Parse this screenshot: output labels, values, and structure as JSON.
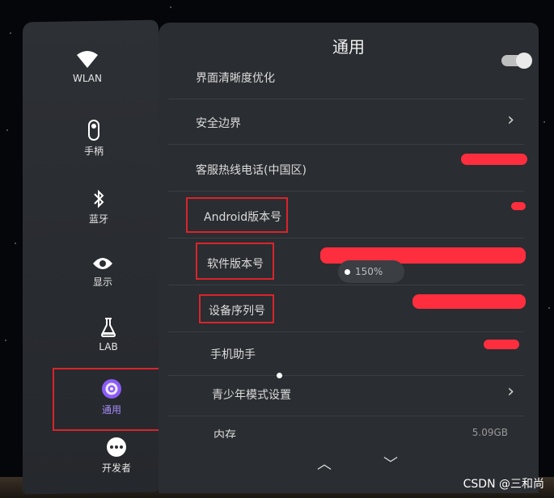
{
  "header": {
    "title": "通用"
  },
  "sidebar": {
    "items": [
      {
        "label": "WLAN",
        "icon": "wifi-icon"
      },
      {
        "label": "手柄",
        "icon": "controller-icon"
      },
      {
        "label": "蓝牙",
        "icon": "bluetooth-icon"
      },
      {
        "label": "显示",
        "icon": "eye-icon"
      },
      {
        "label": "LAB",
        "icon": "flask-icon"
      },
      {
        "label": "通用",
        "icon": "gear-icon",
        "active": true
      },
      {
        "label": "开发者",
        "icon": "dots-icon"
      }
    ]
  },
  "settings": {
    "rows": [
      {
        "label": "界面清晰度优化",
        "control": "toggle"
      },
      {
        "label": "安全边界",
        "control": "chevron"
      },
      {
        "label": "客服热线电话(中国区)",
        "control": "redacted"
      },
      {
        "label": "Android版本号",
        "control": "redacted"
      },
      {
        "label": "软件版本号",
        "control": "redacted"
      },
      {
        "label": "设备序列号",
        "control": "redacted"
      },
      {
        "label": "手机助手",
        "control": "redacted"
      },
      {
        "label": "青少年模式设置",
        "control": "chevron"
      },
      {
        "label": "内存",
        "value": "5.09GB"
      }
    ]
  },
  "overlay": {
    "zoom_label": "150%"
  },
  "footer": {
    "watermark": "CSDN @三和尚"
  },
  "colors": {
    "highlight_box": "#d9242b",
    "active_label": "#a78bfa",
    "redaction": "#ff2e3e"
  }
}
